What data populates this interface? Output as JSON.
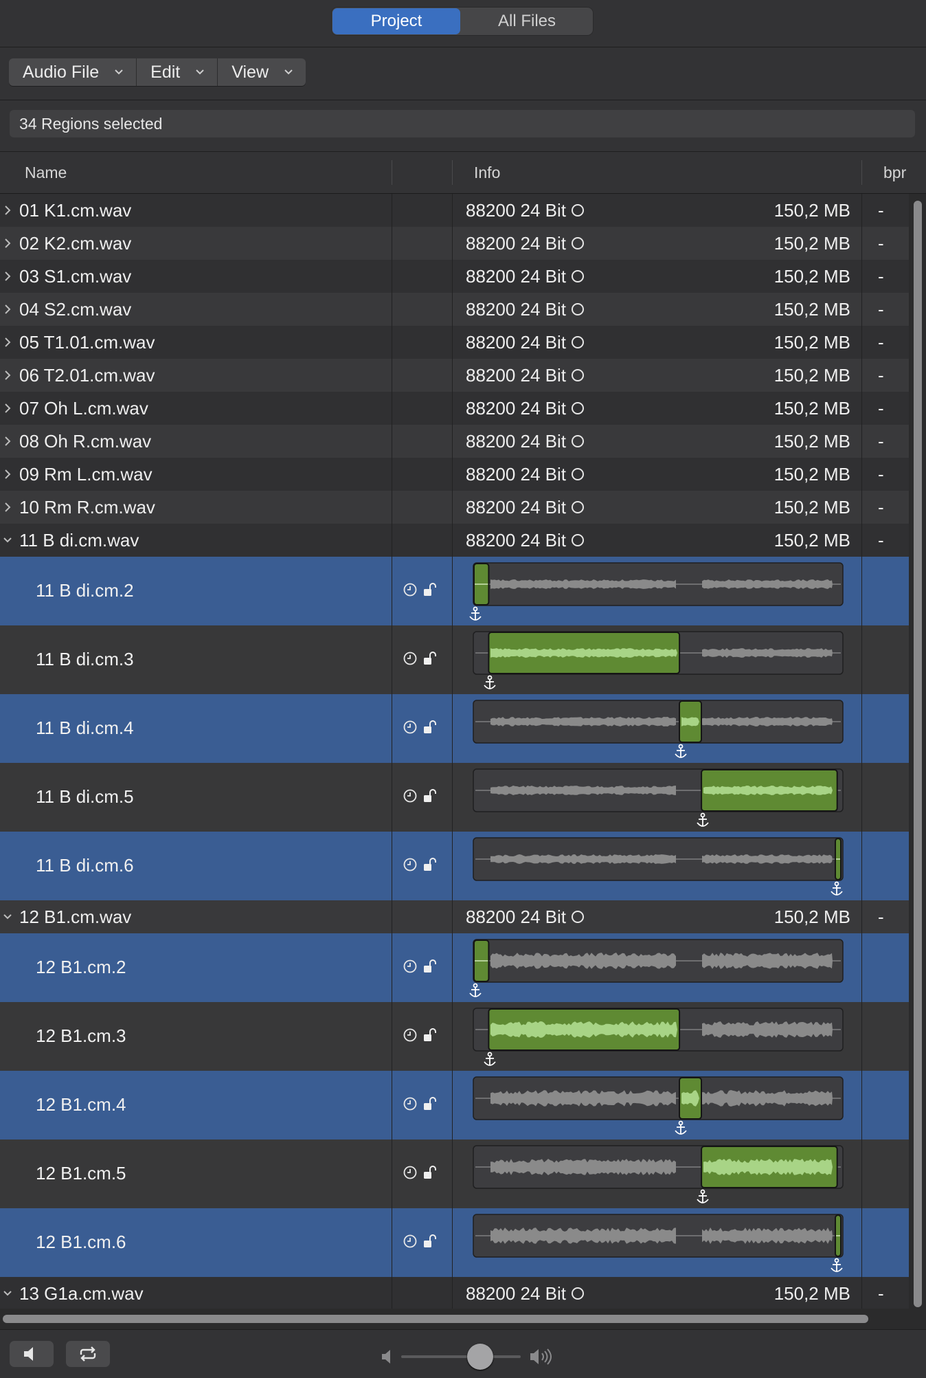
{
  "tabs": {
    "project": "Project",
    "all_files": "All Files",
    "active": "project"
  },
  "toolbar": {
    "menus": [
      "Audio File",
      "Edit",
      "View"
    ]
  },
  "selection": {
    "status": "34 Regions selected"
  },
  "columns": {
    "name": "Name",
    "info": "Info",
    "bpm": "bpr"
  },
  "rows": [
    {
      "type": "file",
      "name": "01 K1.cm.wav",
      "info": "88200 24 Bit",
      "size": "150,2 MB",
      "bpm": "-",
      "expanded": false
    },
    {
      "type": "file",
      "name": "02 K2.cm.wav",
      "info": "88200 24 Bit",
      "size": "150,2 MB",
      "bpm": "-",
      "expanded": false
    },
    {
      "type": "file",
      "name": "03 S1.cm.wav",
      "info": "88200 24 Bit",
      "size": "150,2 MB",
      "bpm": "-",
      "expanded": false
    },
    {
      "type": "file",
      "name": "04 S2.cm.wav",
      "info": "88200 24 Bit",
      "size": "150,2 MB",
      "bpm": "-",
      "expanded": false
    },
    {
      "type": "file",
      "name": "05 T1.01.cm.wav",
      "info": "88200 24 Bit",
      "size": "150,2 MB",
      "bpm": "-",
      "expanded": false
    },
    {
      "type": "file",
      "name": "06 T2.01.cm.wav",
      "info": "88200 24 Bit",
      "size": "150,2 MB",
      "bpm": "-",
      "expanded": false
    },
    {
      "type": "file",
      "name": "07 Oh L.cm.wav",
      "info": "88200 24 Bit",
      "size": "150,2 MB",
      "bpm": "-",
      "expanded": false
    },
    {
      "type": "file",
      "name": "08 Oh R.cm.wav",
      "info": "88200 24 Bit",
      "size": "150,2 MB",
      "bpm": "-",
      "expanded": false
    },
    {
      "type": "file",
      "name": "09 Rm L.cm.wav",
      "info": "88200 24 Bit",
      "size": "150,2 MB",
      "bpm": "-",
      "expanded": false
    },
    {
      "type": "file",
      "name": "10 Rm R.cm.wav",
      "info": "88200 24 Bit",
      "size": "150,2 MB",
      "bpm": "-",
      "expanded": false
    },
    {
      "type": "file",
      "name": "11 B di.cm.wav",
      "info": "88200 24 Bit",
      "size": "150,2 MB",
      "bpm": "-",
      "expanded": true
    },
    {
      "type": "region",
      "name": "11 B di.cm.2",
      "selected": true,
      "region_start": 0.0,
      "region_end": 0.04,
      "dense": false
    },
    {
      "type": "region",
      "name": "11 B di.cm.3",
      "selected": false,
      "region_start": 0.04,
      "region_end": 0.56,
      "dense": false
    },
    {
      "type": "region",
      "name": "11 B di.cm.4",
      "selected": true,
      "region_start": 0.56,
      "region_end": 0.62,
      "dense": false
    },
    {
      "type": "region",
      "name": "11 B di.cm.5",
      "selected": false,
      "region_start": 0.62,
      "region_end": 0.99,
      "dense": false
    },
    {
      "type": "region",
      "name": "11 B di.cm.6",
      "selected": true,
      "region_start": 0.985,
      "region_end": 1.0,
      "dense": false
    },
    {
      "type": "file",
      "name": "12 B1.cm.wav",
      "info": "88200 24 Bit",
      "size": "150,2 MB",
      "bpm": "-",
      "expanded": true
    },
    {
      "type": "region",
      "name": "12 B1.cm.2",
      "selected": true,
      "region_start": 0.0,
      "region_end": 0.04,
      "dense": true
    },
    {
      "type": "region",
      "name": "12 B1.cm.3",
      "selected": false,
      "region_start": 0.04,
      "region_end": 0.56,
      "dense": true
    },
    {
      "type": "region",
      "name": "12 B1.cm.4",
      "selected": true,
      "region_start": 0.56,
      "region_end": 0.62,
      "dense": true
    },
    {
      "type": "region",
      "name": "12 B1.cm.5",
      "selected": false,
      "region_start": 0.62,
      "region_end": 0.99,
      "dense": true
    },
    {
      "type": "region",
      "name": "12 B1.cm.6",
      "selected": true,
      "region_start": 0.985,
      "region_end": 1.0,
      "dense": true
    },
    {
      "type": "file",
      "name": "13 G1a.cm.wav",
      "info": "88200 24 Bit",
      "size": "150,2 MB",
      "bpm": "-",
      "expanded": true
    }
  ],
  "icons": {
    "region_status": [
      "clock-icon",
      "unlock-icon"
    ],
    "anchor": "anchor-icon",
    "bottom": [
      "speaker-icon",
      "loop-icon",
      "volume-low-icon",
      "volume-high-icon"
    ]
  },
  "colors": {
    "selection": "#3a5d93",
    "region_green": "#5f8a33",
    "waveform": "#8f8f8f",
    "accent": "#3a6fc0"
  },
  "volume": {
    "level": 0.62
  }
}
